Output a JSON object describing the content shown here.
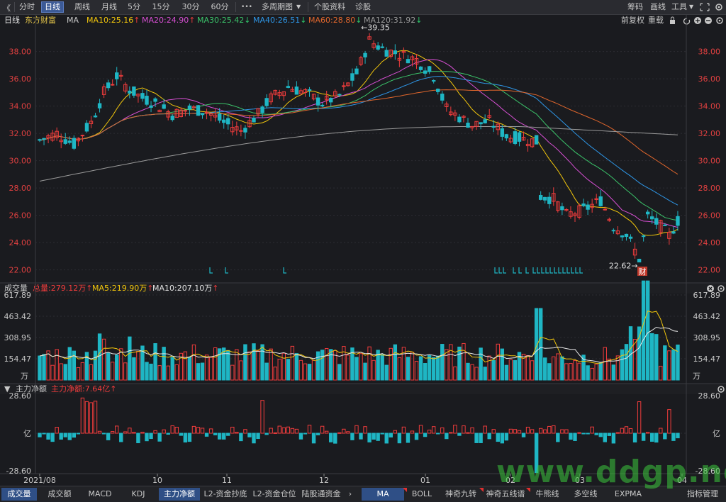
{
  "toolbar": {
    "back_label": "《",
    "tabs": [
      {
        "label": "分时"
      },
      {
        "label": "日线"
      },
      {
        "label": "周线"
      },
      {
        "label": "月线"
      },
      {
        "label": "5分"
      },
      {
        "label": "15分"
      },
      {
        "label": "30分"
      },
      {
        "label": "60分"
      }
    ],
    "more_label": "•••",
    "multi_period_label": "多周期图",
    "dropdown_glyph": "▼",
    "stock_info_label": "个股资料",
    "diagnose_label": "诊股",
    "right_items": [
      "筹码",
      "画线",
      "工具"
    ],
    "tools_dropdown_glyph": "▼"
  },
  "legend": {
    "period": "日线",
    "stock_name": "东方财富",
    "ma_label": "MA",
    "ma10": "MA10:25.16",
    "ma20": "MA20:24.90",
    "ma30": "MA30:25.42",
    "ma40": "MA40:26.51",
    "ma60": "MA60:28.80",
    "ma120": "MA120:31.92",
    "up_arrow": "↑",
    "down_arrow": "↓",
    "adjust_label": "前复权",
    "reset_label": "重载"
  },
  "colors": {
    "ma10": "#f2c60c",
    "ma20": "#d74fd3",
    "ma30": "#3bc46a",
    "ma40": "#2e96e6",
    "ma60": "#e0662c",
    "ma120": "#9a9a9a",
    "up": "#f03c3c",
    "down": "#1fb6c4",
    "axis_text": "#e04040",
    "grid": "#2c2d33"
  },
  "price_axis": {
    "ticks": [
      "38.00",
      "36.00",
      "34.00",
      "32.00",
      "30.00",
      "28.00",
      "26.00",
      "24.00",
      "22.00"
    ],
    "high_annotation": "←39.35",
    "low_annotation": "22.62→",
    "finance_badge": "财"
  },
  "volume_panel": {
    "title": "成交量",
    "total": "总量:279.12万",
    "ma5": "MA5:219.90万",
    "ma10": "MA10:207.10万",
    "up_arrow": "↑",
    "ticks": [
      "617.89",
      "463.42",
      "308.95",
      "154.47"
    ],
    "unit": "万"
  },
  "flow_panel": {
    "title": "主力净额",
    "value": "主力净额:7.64亿",
    "up_arrow": "↑",
    "ticks": [
      "28.60",
      "亿",
      "-28.60"
    ]
  },
  "date_axis": {
    "labels": [
      "2021/08",
      "10",
      "11",
      "12",
      "01",
      "02",
      "03",
      "04"
    ]
  },
  "bottom_tabs": {
    "left": [
      "成交量",
      "成交额",
      "MACD",
      "KDJ",
      "主力净额",
      "L2-资金抄底",
      "L2-资金仓位",
      "陆股通资金"
    ],
    "arrow": "›",
    "right": [
      "MA",
      "BOLL",
      "神奇九转",
      "神奇五线谱",
      "牛熊线",
      "多空线",
      "EXPMA",
      "指标管理"
    ]
  },
  "watermark": "www.ddgp.net",
  "chart_data": {
    "type": "candlestick",
    "price_ylim": [
      21.2,
      39.8
    ],
    "price_high": 39.35,
    "price_low": 22.62,
    "volume_ylim": [
      0,
      617.89
    ],
    "flow_ylim": [
      -28.6,
      28.6
    ],
    "ma_current": {
      "MA10": 25.16,
      "MA20": 24.9,
      "MA30": 25.42,
      "MA40": 26.51,
      "MA60": 28.8,
      "MA120": 31.92
    }
  }
}
